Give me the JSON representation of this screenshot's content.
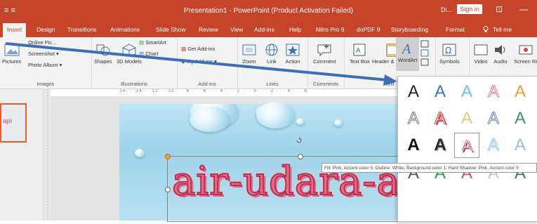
{
  "titlebar": {
    "quick_access": "≡ ≡",
    "title": "Presentation1 - PowerPoint (Product Activation Failed)",
    "user": "Di...",
    "sign_in": "Sign in",
    "restore": "⊡",
    "minimize": "—"
  },
  "tabs": [
    "Insert",
    "Design",
    "Transitions",
    "Animations",
    "Slide Show",
    "Review",
    "View",
    "Add-ins",
    "Help",
    "Nitro Pro 9",
    "doPDF 9",
    "Storyboarding",
    "Format",
    "Tell me"
  ],
  "tell_me_icon": "lightbulb-icon",
  "ribbon": {
    "images": {
      "label": "Images",
      "pictures": "Pictures",
      "online": "Online Pic...",
      "screenshot": "Screenshot",
      "photo_album": "Photo Album"
    },
    "illustrations": {
      "label": "Illustrations",
      "shapes": "Shapes",
      "models": "3D Models",
      "smartart": "SmartArt",
      "chart": "Chart"
    },
    "addins": {
      "label": "Add-ins",
      "get": "Get Add-ins",
      "my": "My Add-ins"
    },
    "links": {
      "label": "Links",
      "zoom": "Zoom",
      "link": "Link",
      "action": "Action"
    },
    "comments": {
      "label": "Comments",
      "comment": "Comment"
    },
    "text": {
      "label": "Text",
      "textbox": "Text Box",
      "header": "Header & Footer",
      "wordart": "WordArt"
    },
    "symbols": {
      "symbols": "Symbols"
    },
    "media": {
      "video": "Video",
      "audio": "Audio",
      "screen": "Screen Recording"
    }
  },
  "ruler": "·16· · ·14· · ·12· · ·10· · · 8 · · · 6 · · · 4 · · · 2 · · · 0 · · · 2 · · · 4 · · · 6",
  "wordart_text": "air-udara-api",
  "gallery": [
    {
      "letter": "A",
      "color": "#222222"
    },
    {
      "letter": "A",
      "color": "#3b6fc4"
    },
    {
      "letter": "A",
      "color": "#7fc4e8"
    },
    {
      "letter": "A",
      "color": "#f3b3c6"
    },
    {
      "letter": "A",
      "color": "#e8a040"
    },
    {
      "letter": "A",
      "color": "#8a8a8a"
    },
    {
      "letter": "A",
      "color": "#d04848"
    },
    {
      "letter": "A",
      "color": "#f2c77a"
    },
    {
      "letter": "A",
      "color": "#6a7fc0"
    },
    {
      "letter": "A",
      "color": "#3f9a5a"
    },
    {
      "letter": "A",
      "color": "#1a1a1a"
    },
    {
      "letter": "A",
      "color": "#2a2a2a"
    },
    {
      "letter": "A",
      "color": "#d83b5e"
    },
    {
      "letter": "A",
      "color": "#8cc8ea"
    },
    {
      "letter": "A",
      "color": "#5c8fc8"
    },
    {
      "letter": "A",
      "color": "#555555"
    },
    {
      "letter": "A",
      "color": "#2d9a5a"
    },
    {
      "letter": "A",
      "color": "#d84a6a"
    },
    {
      "letter": "A",
      "color": "#c8c8c8"
    },
    {
      "letter": "A",
      "color": "#3a7a5a"
    }
  ],
  "tooltip": "Fill: Pink, Accent color 5; Outline: White, Background color 1; Hard Shadow: Pink, Accent color 5",
  "colors": {
    "accent": "#c6452a",
    "wordart_fill": "#e56b8a",
    "arrow": "#3d6fb8"
  }
}
